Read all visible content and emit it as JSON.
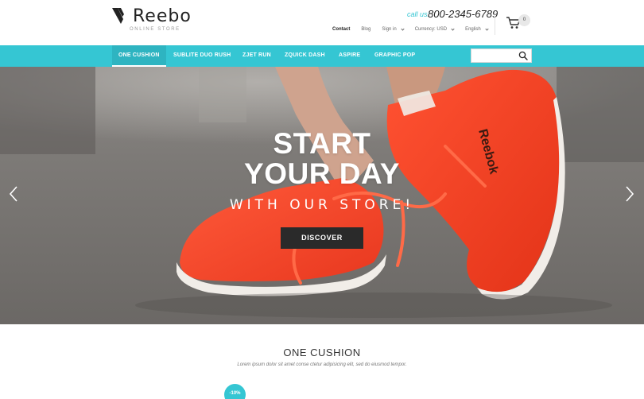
{
  "brand": {
    "name": "Reebo",
    "tagline": "ONLINE STORE"
  },
  "contact": {
    "call_label": "call us:",
    "phone": "800-2345-6789"
  },
  "toplinks": {
    "contact": "Contact",
    "blog": "Blog",
    "signin": "Sign in",
    "currency": "Currency: USD",
    "language": "English"
  },
  "cart": {
    "count": "0"
  },
  "nav": {
    "items": [
      {
        "label": "ONE CUSHION"
      },
      {
        "label": "SUBLITE DUO RUSH"
      },
      {
        "label": "ZJET RUN"
      },
      {
        "label": "ZQUICK DASH"
      },
      {
        "label": "ASPIRE"
      },
      {
        "label": "GRAPHIC POP"
      }
    ],
    "search_placeholder": ""
  },
  "hero": {
    "line1": "START",
    "line2": "YOUR DAY",
    "subtitle": "WITH OUR STORE!",
    "button": "DISCOVER",
    "shoe_brand": "Reebok"
  },
  "section": {
    "title": "ONE CUSHION",
    "description": "Lorem ipsum dolor sit amet conse ctetur adipisicing elit, sed do eiusmod tempor.",
    "badge": "-10%"
  },
  "colors": {
    "accent": "#35c6d3",
    "shoe": "#ff4a2e",
    "button": "#2a2a2a"
  },
  "icons": [
    "brand-logo-icon",
    "cart-icon",
    "search-icon",
    "chevron-left-icon",
    "chevron-right-icon",
    "chevron-down-icon"
  ]
}
